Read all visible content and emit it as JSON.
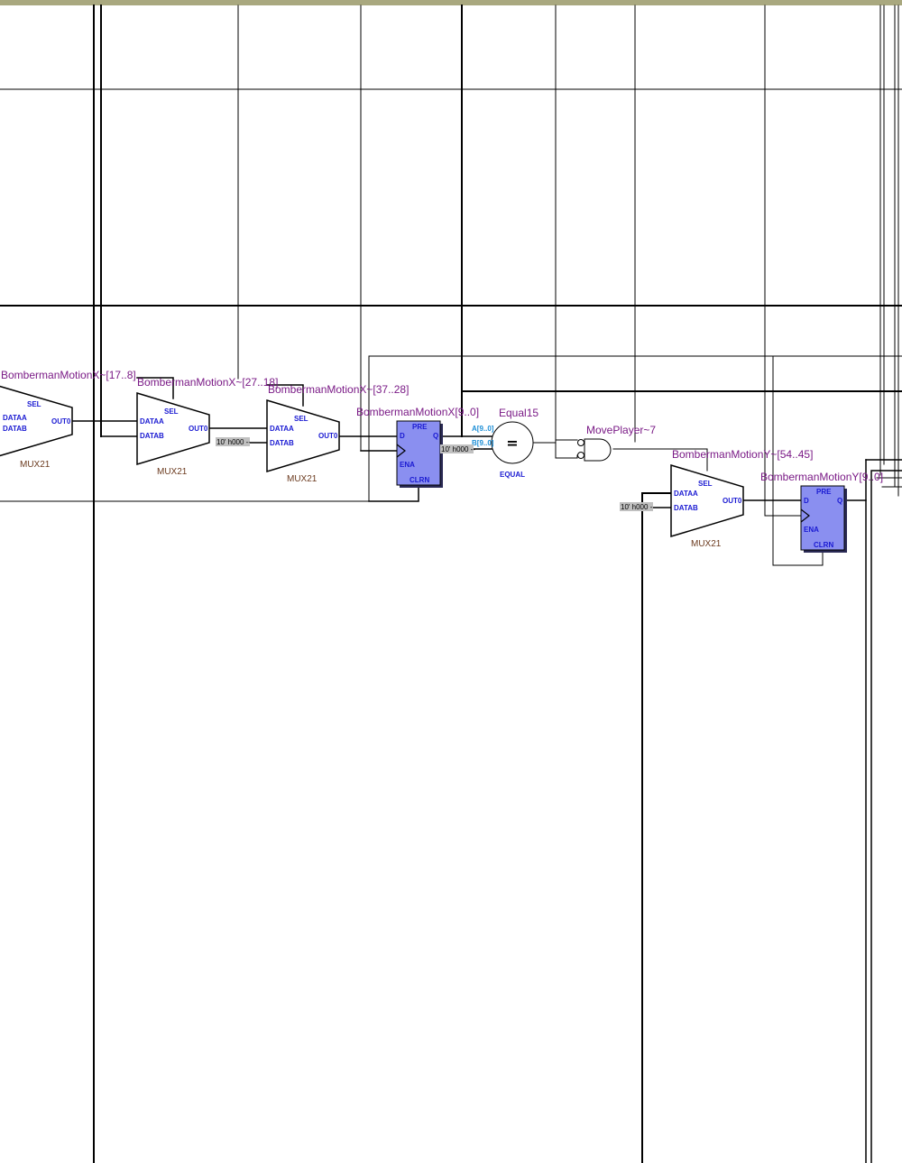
{
  "colors": {
    "top_bar": "#a9a87f",
    "wire": "#000000",
    "instance_label": "#7a1a86",
    "port_label": "#1a1ad2",
    "equal_port_label": "#1e8fd6",
    "type_label": "#6b3a1e",
    "register_fill": "#8a8ff0",
    "register_shadow": "#2a2a55",
    "constant_fill": "#c0c0c0"
  },
  "mux": {
    "type_label": "MUX21",
    "ports": {
      "sel": "SEL",
      "data_a": "DATAA",
      "data_b": "DATAB",
      "out": "OUT0"
    }
  },
  "register": {
    "ports": {
      "pre": "PRE",
      "d": "D",
      "q": "Q",
      "ena": "ENA",
      "clrn": "CLRN"
    }
  },
  "comparator": {
    "name": "Equal15",
    "symbol": "=",
    "type_label": "EQUAL",
    "port_a": "A[9..0]",
    "port_b": "B[9..0]"
  },
  "and_gate": {
    "name": "MovePlayer~7"
  },
  "instances": {
    "mux_x_17_8": "BombermanMotionX~[17..8]",
    "mux_x_27_18": "BombermanMotionX~[27..18]",
    "mux_x_37_28": "BombermanMotionX~[37..28]",
    "reg_x": "BombermanMotionX[9..0]",
    "mux_y_54_45": "BombermanMotionY~[54..45]",
    "reg_y": "BombermanMotionY[9..0]"
  },
  "constants": {
    "mux_x_27_18_datab": "10' h000 --",
    "equal_b": "10' h000 --",
    "mux_y_datab": "10' h000 --"
  }
}
